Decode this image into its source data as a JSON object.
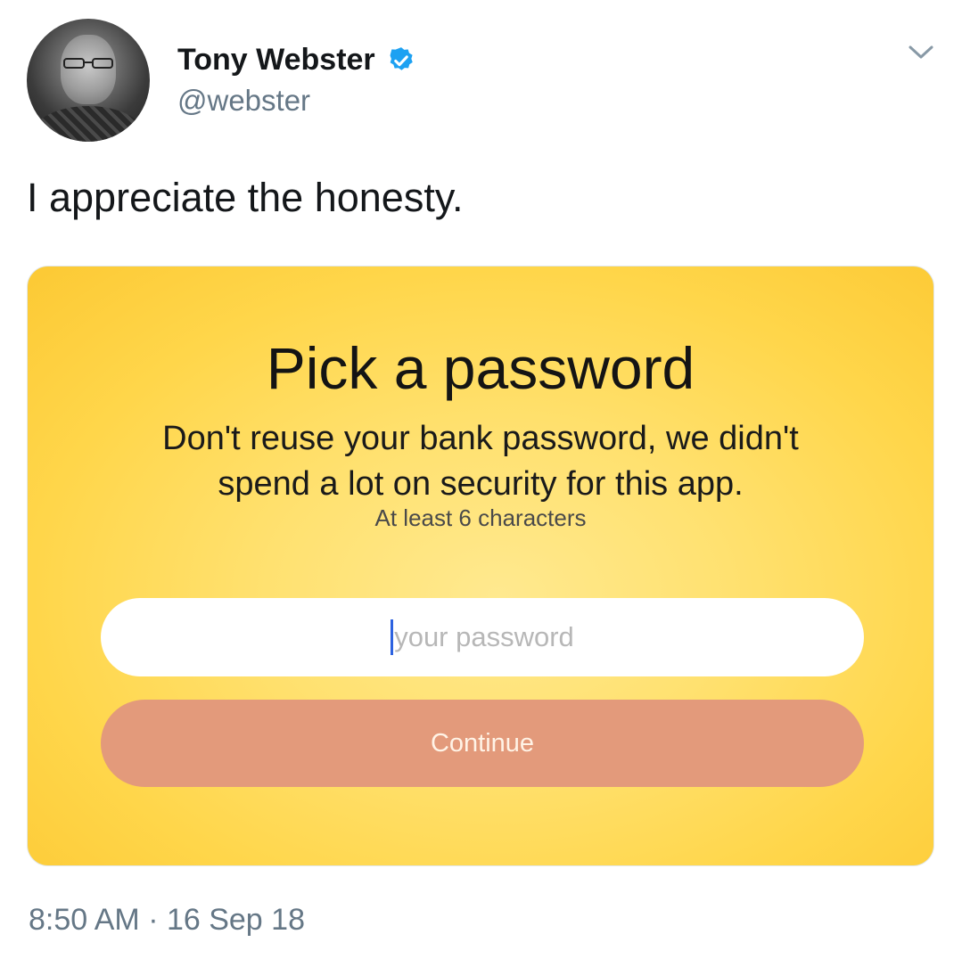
{
  "tweet": {
    "author_name": "Tony Webster",
    "author_handle": "@webster",
    "verified_icon": "verified-badge-icon",
    "menu_icon": "chevron-down-icon",
    "text": "I appreciate the honesty.",
    "timestamp": "8:50 AM · 16 Sep 18"
  },
  "card": {
    "title": "Pick a password",
    "subtitle_line1": "Don't reuse your bank password, we didn't",
    "subtitle_line2": "spend a lot on security for this app.",
    "hint": "At least 6 characters",
    "password_placeholder": "your password",
    "continue_label": "Continue"
  },
  "colors": {
    "verified_blue": "#1da1f2",
    "card_yellow": "#ffd64a",
    "button_salmon": "#e39a7b",
    "handle_gray": "#657786"
  }
}
